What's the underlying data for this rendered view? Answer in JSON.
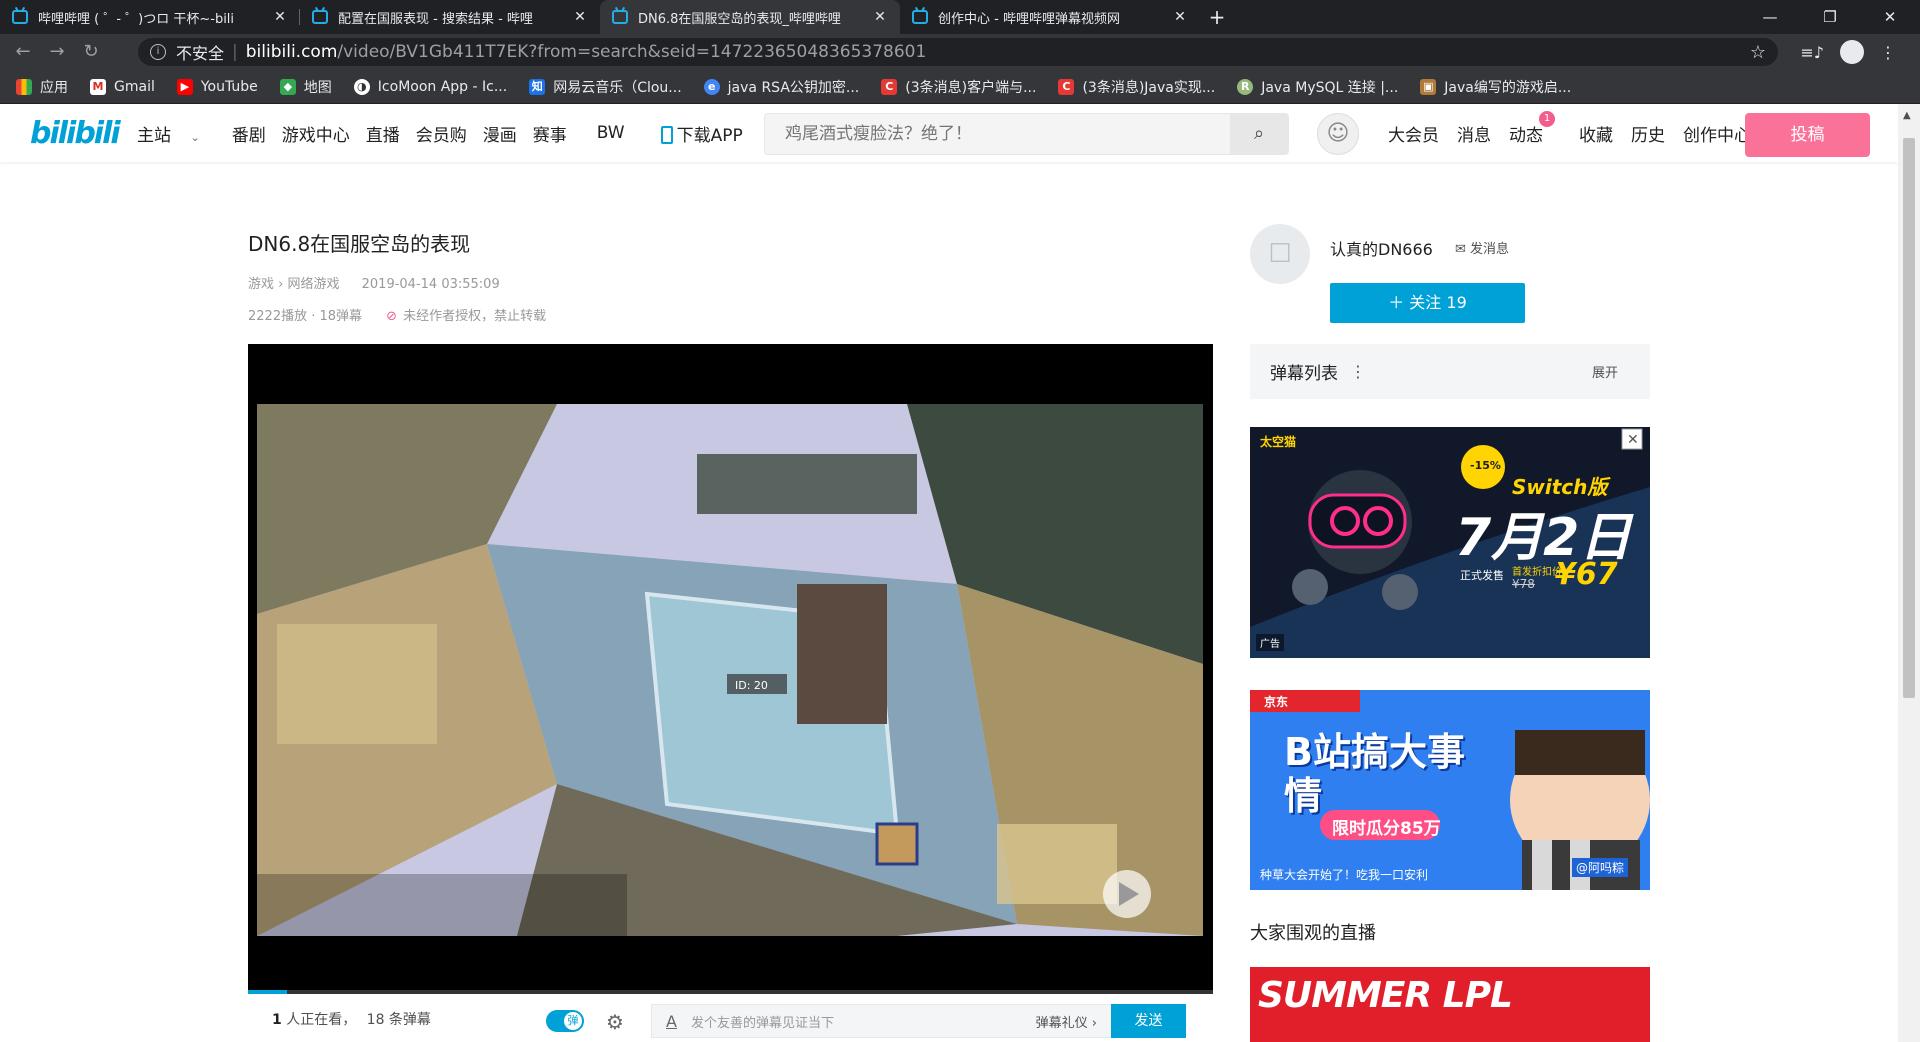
{
  "browser": {
    "tabs": [
      {
        "title": "哔哩哔哩 ( ゜- ゜)つロ 干杯~-bili",
        "active": false
      },
      {
        "title": "配置在国服表现 - 搜索结果 - 哔哩",
        "active": false
      },
      {
        "title": "DN6.8在国服空岛的表现_哔哩哔哩",
        "active": true
      },
      {
        "title": "创作中心 - 哔哩哔哩弹幕视频网",
        "active": false
      }
    ],
    "new_tab": "+",
    "win_min": "—",
    "win_max": "❐",
    "win_close": "✕",
    "insecure_label": "不安全",
    "url_host": "bilibili.com",
    "url_path": "/video/BV1Gb411T7EK?from=search&seid=14722365048365378601",
    "bookmarks": [
      {
        "label": "应用",
        "icon": "apps-icon",
        "color": "#ea4335"
      },
      {
        "label": "Gmail",
        "icon": "gmail-icon",
        "color": "#d93025"
      },
      {
        "label": "YouTube",
        "icon": "youtube-icon",
        "color": "#ff0000"
      },
      {
        "label": "地图",
        "icon": "maps-icon",
        "color": "#34a853"
      },
      {
        "label": "IcoMoon App - Ic...",
        "icon": "icomoon-icon",
        "color": "#555"
      },
      {
        "label": "网易云音乐（Clou...",
        "icon": "netease-icon",
        "color": "#1a73e8"
      },
      {
        "label": "java RSA公钥加密...",
        "icon": "globe-icon",
        "color": "#4285f4"
      },
      {
        "label": "(3条消息)客户端与...",
        "icon": "csdn-icon",
        "color": "#e53935"
      },
      {
        "label": "(3条消息)Java实现...",
        "icon": "csdn-icon",
        "color": "#e53935"
      },
      {
        "label": "Java MySQL 连接 |...",
        "icon": "runoob-icon",
        "color": "#96b97d"
      },
      {
        "label": "Java编写的游戏启...",
        "icon": "box-icon",
        "color": "#b07a3a"
      }
    ]
  },
  "bili": {
    "logo": "bilibili",
    "nav_left": [
      "主站",
      "番剧",
      "游戏中心",
      "直播",
      "会员购",
      "漫画",
      "赛事",
      "BW",
      "下载APP"
    ],
    "search_placeholder": "鸡尾酒式瘦脸法？绝了！",
    "nav_right": [
      "大会员",
      "消息",
      "动态",
      "收藏",
      "历史",
      "创作中心"
    ],
    "dynamic_badge": "1",
    "upload_button": "投稿"
  },
  "video": {
    "title": "DN6.8在国服空岛的表现",
    "category": "游戏",
    "subcategory": "网络游戏",
    "publish_time": "2019-04-14 03:55:09",
    "stats": "2222播放 · 18弹幕",
    "copyright_notice": "未经作者授权，禁止转载",
    "progress_fraction": 0.04,
    "watching_count": "1",
    "watching_text": "人正在看，",
    "danmaku_count": "18 条弹幕",
    "danmaku_placeholder": "发个友善的弹幕见证当下",
    "danmaku_etiquette": "弹幕礼仪 ›",
    "send_button": "发送",
    "danmaku_toggle": "弹"
  },
  "uploader": {
    "name": "认真的DN666",
    "message_label": "发消息",
    "follow_label": "＋ 关注 19"
  },
  "sidebar": {
    "danmaku_list_title": "弹幕列表",
    "danmaku_list_expand": "展开",
    "ad1_brand": "太空猫",
    "ad1_tag": "Switch版",
    "ad1_date": "7月2日",
    "ad1_price": "¥67",
    "ad1_original": "¥78",
    "ad1_discount": "-15%",
    "ad1_note1": "正式发售",
    "ad1_note2": "首发折扣价",
    "ad_label": "广告",
    "ad2_brand": "京东",
    "ad2_title": "B站搞大事情",
    "ad2_sub": "限时瓜分85万",
    "ad2_caption": "种草大会开始了！吃我一口安利",
    "ad2_handle": "@阿吗粽",
    "live_heading": "大家围观的直播",
    "live_banner": "SUMMER LPL"
  },
  "colors": {
    "bili_blue": "#00a1d6",
    "bili_pink": "#fb7299"
  }
}
